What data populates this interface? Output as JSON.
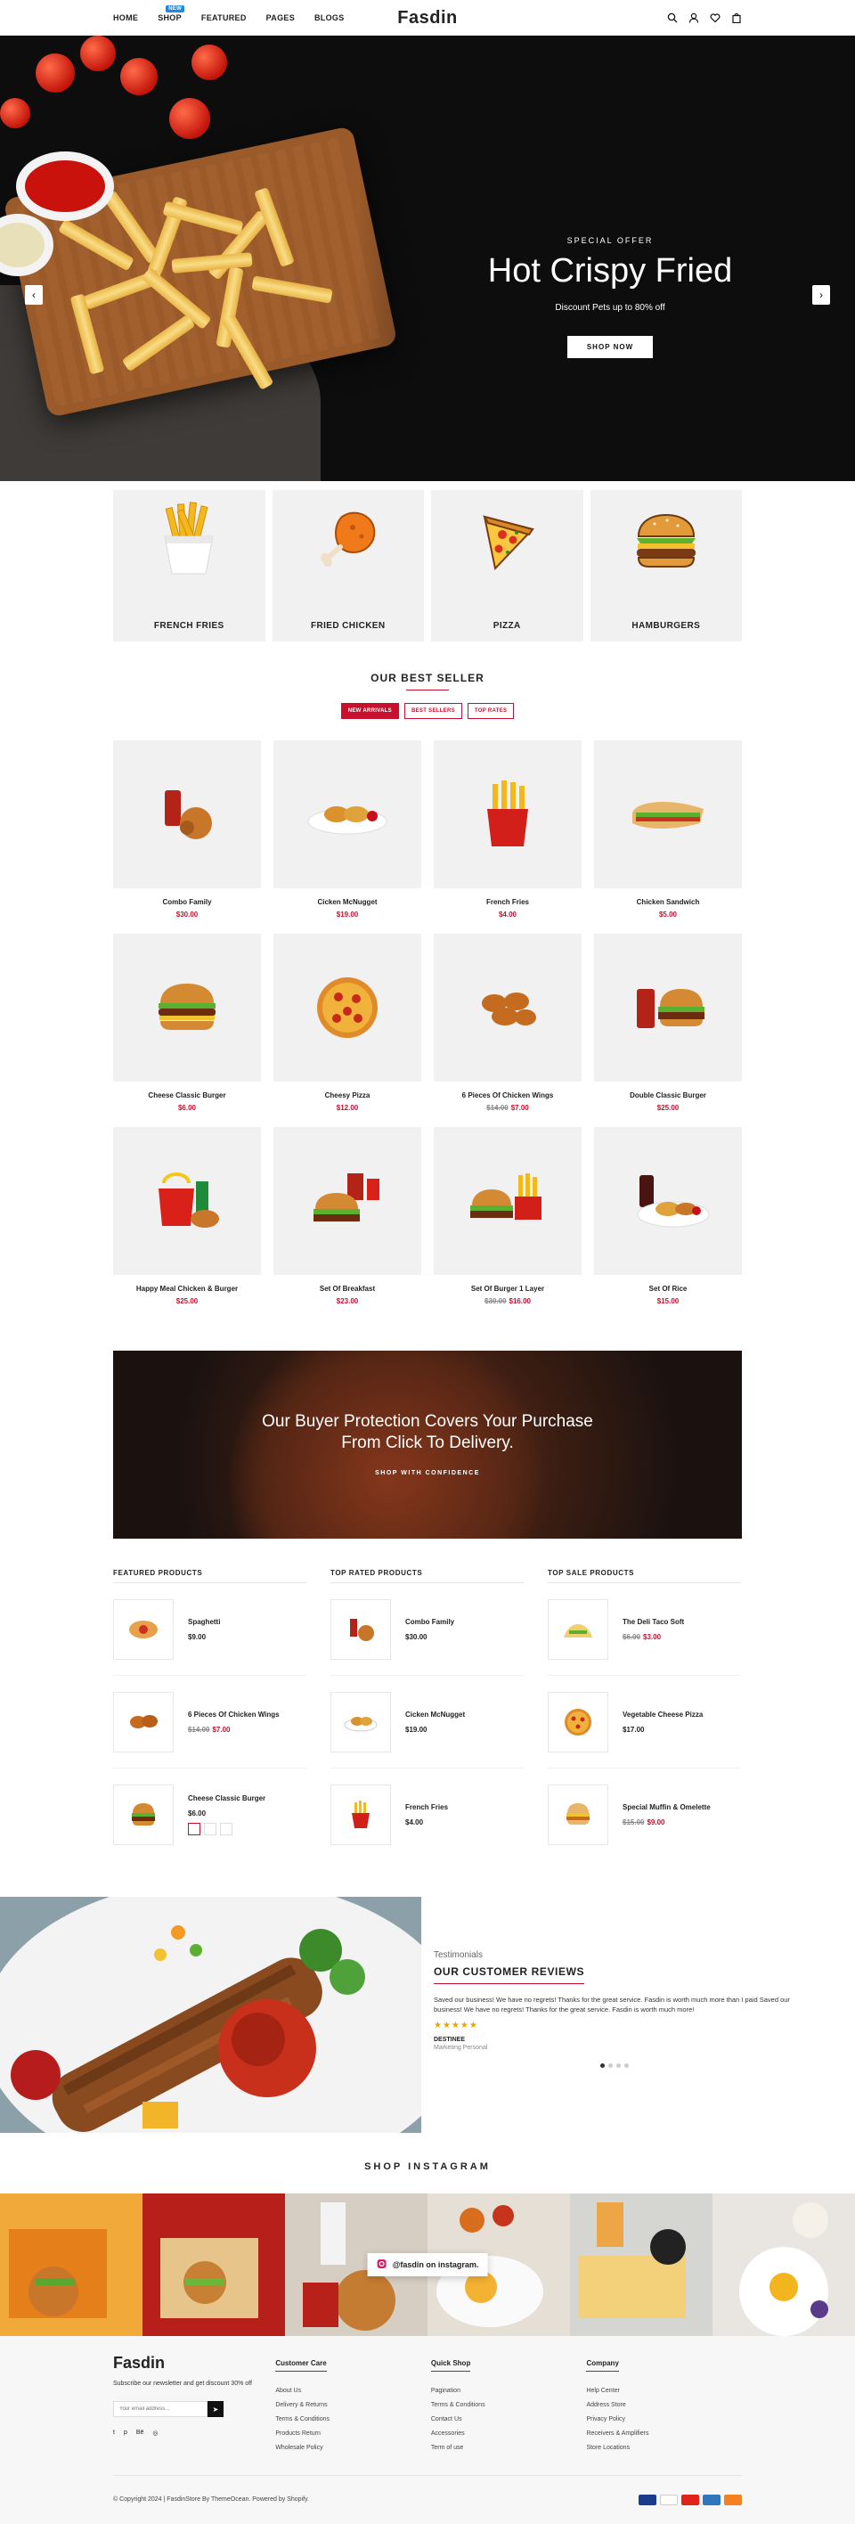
{
  "header": {
    "nav": [
      "HOME",
      "SHOP",
      "FEATURED",
      "PAGES",
      "BLOGS"
    ],
    "shop_badge": "NEW",
    "logo": "Fasdin",
    "icons": [
      "search-icon",
      "user-icon",
      "heart-icon",
      "cart-icon"
    ]
  },
  "hero": {
    "kicker": "SPECIAL OFFER",
    "title": "Hot Crispy Fried",
    "subtitle": "Discount Pets up to 80% off",
    "button": "SHOP NOW",
    "prev": "‹",
    "next": "›"
  },
  "categories": [
    {
      "label": "FRENCH FRIES",
      "icon": "fries-icon"
    },
    {
      "label": "FRIED CHICKEN",
      "icon": "fried-chicken-icon"
    },
    {
      "label": "PIZZA",
      "icon": "pizza-icon"
    },
    {
      "label": "HAMBURGERS",
      "icon": "burger-icon"
    }
  ],
  "best_seller": {
    "title": "OUR BEST SELLER",
    "tabs": [
      "NEW ARRIVALS",
      "BEST SELLERS",
      "TOP RATES"
    ],
    "products": [
      {
        "name": "Combo Family",
        "price": "$30.00",
        "old": ""
      },
      {
        "name": "Cicken McNugget",
        "price": "$19.00",
        "old": ""
      },
      {
        "name": "French Fries",
        "price": "$4.00",
        "old": ""
      },
      {
        "name": "Chicken Sandwich",
        "price": "$5.00",
        "old": ""
      },
      {
        "name": "Cheese Classic Burger",
        "price": "$6.00",
        "old": ""
      },
      {
        "name": "Cheesy Pizza",
        "price": "$12.00",
        "old": ""
      },
      {
        "name": "6 Pieces Of Chicken Wings",
        "price": "$7.00",
        "old": "$14.00"
      },
      {
        "name": "Double Classic Burger",
        "price": "$25.00",
        "old": ""
      },
      {
        "name": "Happy Meal Chicken & Burger",
        "price": "$25.00",
        "old": ""
      },
      {
        "name": "Set Of Breakfast",
        "price": "$23.00",
        "old": ""
      },
      {
        "name": "Set Of Burger 1 Layer",
        "price": "$16.00",
        "old": "$30.00"
      },
      {
        "name": "Set Of Rice",
        "price": "$15.00",
        "old": ""
      }
    ]
  },
  "banner": {
    "line1": "Our Buyer Protection Covers Your Purchase",
    "line2": "From Click To Delivery.",
    "link": "SHOP WITH CONFIDENCE"
  },
  "lists": [
    {
      "title": "FEATURED PRODUCTS",
      "items": [
        {
          "name": "Spaghetti",
          "price": "$9.00",
          "old": ""
        },
        {
          "name": "6 Pieces Of Chicken Wings",
          "price": "$7.00",
          "old": "$14.00"
        },
        {
          "name": "Cheese Classic Burger",
          "price": "$6.00",
          "old": ""
        }
      ]
    },
    {
      "title": "TOP RATED PRODUCTS",
      "items": [
        {
          "name": "Combo Family",
          "price": "$30.00",
          "old": ""
        },
        {
          "name": "Cicken McNugget",
          "price": "$19.00",
          "old": ""
        },
        {
          "name": "French Fries",
          "price": "$4.00",
          "old": ""
        }
      ]
    },
    {
      "title": "TOP SALE PRODUCTS",
      "items": [
        {
          "name": "The Deli Taco Soft",
          "price": "$3.00",
          "old": "$6.00"
        },
        {
          "name": "Vegetable Cheese Pizza",
          "price": "$17.00",
          "old": ""
        },
        {
          "name": "Special Muffin & Omelette",
          "price": "$9.00",
          "old": "$15.00"
        }
      ]
    }
  ],
  "testimonials": {
    "kicker": "Testimonials",
    "title": "OUR CUSTOMER REVIEWS",
    "text": "Saved our business! We have no regrets! Thanks for the great service. Fasdin is worth much more than I paid Saved our business! We have no regrets! Thanks for the great service. Fasdin is worth much more!",
    "stars": "★★★★★",
    "name": "DESTINEE",
    "role": "Marketing Personal"
  },
  "instagram": {
    "title": "SHOP INSTAGRAM",
    "handle": "@fasdin on instagram."
  },
  "footer": {
    "logo": "Fasdin",
    "newsletter": "Subscribe our newsletter and get discount 30% off",
    "email_placeholder": "Your email address...",
    "submit": "➤",
    "social": [
      "t",
      "p",
      "Bē",
      "◎"
    ],
    "columns": [
      {
        "title": "Customer Care",
        "links": [
          "About Us",
          "Delivery & Returns",
          "Terms & Conditions",
          "Products Return",
          "Wholesale Policy"
        ]
      },
      {
        "title": "Quick Shop",
        "links": [
          "Pagination",
          "Terms & Conditions",
          "Contact Us",
          "Accessories",
          "Term of use"
        ]
      },
      {
        "title": "Company",
        "links": [
          "Help Center",
          "Address Store",
          "Privacy Policy",
          "Receivers & Amplifiers",
          "Store Locations"
        ]
      }
    ],
    "copyright": "© Copyright 2024 | FasdinStore By ThemeOcean. Powered by Shopify.",
    "payments": [
      "visa",
      "paypal",
      "mastercard",
      "amex",
      "discover"
    ]
  },
  "colors": {
    "accent": "#c8102e",
    "badge": "#1e88e5"
  }
}
